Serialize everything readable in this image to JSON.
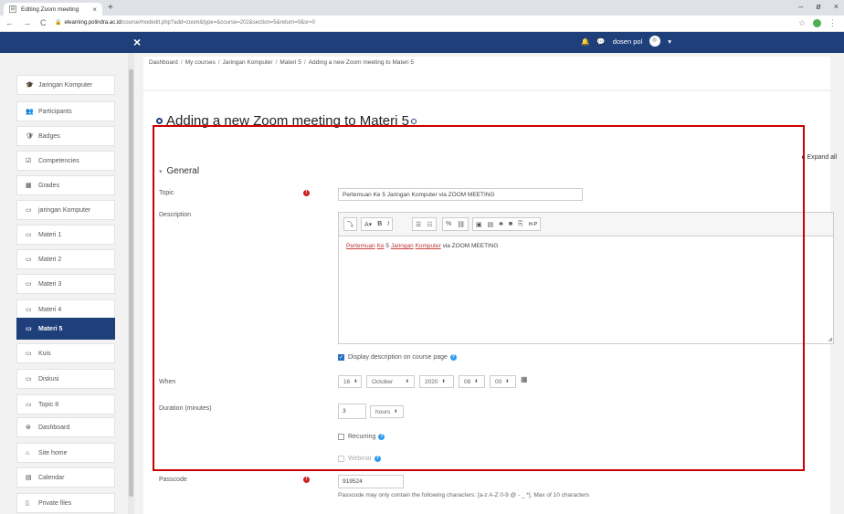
{
  "browser": {
    "tab_title": "Editing Zoom meeting",
    "tab_close": "×",
    "new_tab": "+",
    "window_controls": [
      "–",
      "ø",
      "×"
    ],
    "nav": [
      "←",
      "→",
      "C"
    ],
    "url_host": "elearning.polindra.ac.id",
    "url_path": "/course/modedit.php?add=zoom&type=&course=202&section=5&return=0&sr=0",
    "star": "☆",
    "menu": "⋮"
  },
  "navbar": {
    "close_label": "×",
    "user_name": "dosen pol",
    "bell_icon": "bell-icon",
    "chat_icon": "chat-icon",
    "caret": "▾",
    "color": "#1f3f7a"
  },
  "sidebar": {
    "items": [
      {
        "label": "Jaringan Komputer",
        "icon": "🎓",
        "active": false
      },
      {
        "label": "Participants",
        "icon": "👥",
        "active": false
      },
      {
        "label": "Badges",
        "icon": "🛡",
        "active": false
      },
      {
        "label": "Competencies",
        "icon": "☑",
        "active": false
      },
      {
        "label": "Grades",
        "icon": "▦",
        "active": false
      },
      {
        "label": "jaringan Komputer",
        "icon": "▭",
        "active": false
      },
      {
        "label": "Materi 1",
        "icon": "▭",
        "active": false
      },
      {
        "label": "Materi 2",
        "icon": "▭",
        "active": false
      },
      {
        "label": "Materi 3",
        "icon": "▭",
        "active": false
      },
      {
        "label": "Materi 4",
        "icon": "▭",
        "active": false
      },
      {
        "label": "Materi 5",
        "icon": "▭",
        "active": true
      },
      {
        "label": "Kuis",
        "icon": "▭",
        "active": false
      },
      {
        "label": "Diskusi",
        "icon": "▭",
        "active": false
      },
      {
        "label": "Topic 8",
        "icon": "▭",
        "active": false
      },
      {
        "label": "Dashboard",
        "icon": "⊛",
        "active": false
      },
      {
        "label": "Site home",
        "icon": "⌂",
        "active": false
      },
      {
        "label": "Calendar",
        "icon": "▤",
        "active": false
      },
      {
        "label": "Private files",
        "icon": "▯",
        "active": false
      }
    ]
  },
  "breadcrumb": [
    "Dashboard",
    "My courses",
    "Jaringan Komputer",
    "Materi 5",
    "Adding a new Zoom meeting to Materi 5"
  ],
  "breadcrumb_sep": "/",
  "page_title": "Adding a new Zoom meeting to Materi 5",
  "expand_all": "Expand all",
  "expand_caret": "▸",
  "section_caret": "▾",
  "section_title": "General",
  "form": {
    "topic_label": "Topic",
    "topic_value": "Pertemuan Ke 5 Jaringan Komputer via ZOOM MEETING",
    "required_mark": "!",
    "description_label": "Description",
    "toolbar_group1": [
      "⤵",
      "A▾",
      "B",
      "I",
      "☰",
      "☷",
      "%",
      "⛓",
      "▣",
      "▤",
      "♣",
      "■",
      "⎘",
      "H-P"
    ],
    "description_words": [
      "Pertemuan",
      "Ke",
      "5",
      "Jaringan",
      "Komputer",
      "via ZOOM MEETING"
    ],
    "display_desc_label": "Display description on course page",
    "display_desc_checked": true,
    "checkmark": "✓",
    "help_mark": "?",
    "when_label": "When",
    "when_day": "16",
    "when_month": "October",
    "when_year": "2020",
    "when_hour": "08",
    "when_minute": "00",
    "select_chev": "⬍",
    "calendar_icon": "▦",
    "duration_label": "Duration (minutes)",
    "duration_value": "3",
    "duration_unit": "hours",
    "recurring_label": "Recurring",
    "webinar_label": "Webinar",
    "passcode_label": "Passcode",
    "passcode_value": "919524",
    "passcode_hint": "Passcode may only contain the following characters: [a-z A-Z 0-9 @ - _ *]. Max of 10 characters"
  },
  "highlight_color": "#cc0000"
}
